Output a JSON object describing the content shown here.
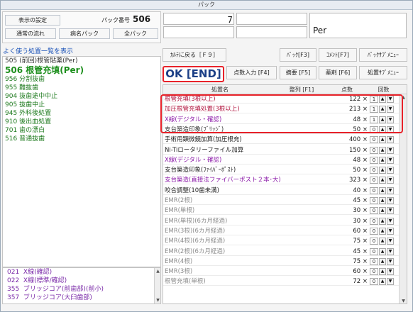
{
  "window": {
    "title": "パック"
  },
  "left_panel": {
    "display_settings": "表示の設定",
    "normal_flow": "通常の流れ",
    "disease_pack": "病名パック",
    "all_pack": "全パック",
    "pack_number_label": "パック番号",
    "pack_number": "506",
    "favorites_link": "よく使う処置一覧を表示",
    "list": [
      {
        "code": "505",
        "name": "(前回)根管貼薬(Per)"
      },
      {
        "code": "506",
        "name": "根管充填(Per)"
      },
      {
        "code": "956",
        "name": "分割抜歯"
      },
      {
        "code": "955",
        "name": "難抜歯"
      },
      {
        "code": "904",
        "name": "抜歯途中中止"
      },
      {
        "code": "905",
        "name": "抜歯中止"
      },
      {
        "code": "945",
        "name": "外科後処置"
      },
      {
        "code": "910",
        "name": "後出血処置"
      },
      {
        "code": "701",
        "name": "歯の漂白"
      },
      {
        "code": "516",
        "name": "普通抜歯"
      }
    ],
    "list2": [
      {
        "code": "021",
        "name": "X線(確認)"
      },
      {
        "code": "022",
        "name": "X線(標準/確認)"
      },
      {
        "code": "355",
        "name": "ブリッジコア(前歯部)(前小)"
      },
      {
        "code": "357",
        "name": "ブリッジコア(大臼歯部)"
      }
    ]
  },
  "right_panel": {
    "top_number": "7",
    "per_label": "Per",
    "buttons": {
      "back": "ｶﾙﾃに戻る［Ｆ９］",
      "pack": "ﾊﾟｯｸ[F3]",
      "comment": "ｺﾒﾝﾄ[F7]",
      "pack_submenu": "ﾊﾟｯｸｻﾌﾞﾒﾆｭｰ",
      "ok": "OK [END]",
      "points_input": "点数入力 [F4]",
      "summary": "摘要 [F5]",
      "drug": "薬剤 [F6]",
      "proc_submenu": "処置ｻﾌﾞﾒﾆｭｰ"
    },
    "grid": {
      "columns": {
        "name": "処置名",
        "sort": "整列 [F1]",
        "points": "点数",
        "count": "回数"
      },
      "rows": [
        {
          "name": "根管充填(3根以上)",
          "points": "122 ×",
          "count": "1",
          "color": "#b0123c"
        },
        {
          "name": "加圧根管充填処置(3根以上)",
          "points": "213 ×",
          "count": "1",
          "color": "#b0123c"
        },
        {
          "name": "X線(デジタル・確認)",
          "points": "48 ×",
          "count": "1",
          "color": "#8b1aa8"
        },
        {
          "name": "支台築造印象(ﾌﾞﾘｯｼﾞ)",
          "points": "50 ×",
          "count": "0",
          "color": "#333333"
        },
        {
          "name": "手術用顕微鏡加算(加圧根充)",
          "points": "400 ×",
          "count": "0",
          "color": "#222222"
        },
        {
          "name": "Ni-Tiロータリーファイル加算",
          "points": "150 ×",
          "count": "0",
          "color": "#222222"
        },
        {
          "name": "X線(デジタル・確認)",
          "points": "48 ×",
          "count": "0",
          "color": "#8b1aa8"
        },
        {
          "name": "支台築造印象(ﾌｧｲﾊﾞｰﾎﾟｽﾄ)",
          "points": "50 ×",
          "count": "0",
          "color": "#222222"
        },
        {
          "name": "支台築造(直接法ファイバーポスト２本･大)",
          "points": "323 ×",
          "count": "0",
          "color": "#8b1aa8"
        },
        {
          "name": "咬合調整(10歯未満)",
          "points": "40 ×",
          "count": "0",
          "color": "#222222"
        },
        {
          "name": "EMR(2根)",
          "points": "45 ×",
          "count": "0",
          "color": "#8c8c8c"
        },
        {
          "name": "EMR(単根)",
          "points": "30 ×",
          "count": "0",
          "color": "#8c8c8c"
        },
        {
          "name": "EMR(単根)(6カ月経過)",
          "points": "30 ×",
          "count": "0",
          "color": "#8c8c8c"
        },
        {
          "name": "EMR(3根)(6カ月経過)",
          "points": "60 ×",
          "count": "0",
          "color": "#8c8c8c"
        },
        {
          "name": "EMR(4根)(6カ月経過)",
          "points": "75 ×",
          "count": "0",
          "color": "#8c8c8c"
        },
        {
          "name": "EMR(2根)(6カ月経過)",
          "points": "45 ×",
          "count": "0",
          "color": "#8c8c8c"
        },
        {
          "name": "EMR(4根)",
          "points": "75 ×",
          "count": "0",
          "color": "#8c8c8c"
        },
        {
          "name": "EMR(3根)",
          "points": "60 ×",
          "count": "0",
          "color": "#8c8c8c"
        },
        {
          "name": "根管充填(単根)",
          "points": "72 ×",
          "count": "0",
          "color": "#8c8c8c"
        }
      ]
    }
  },
  "icons": {
    "up": "▲",
    "down": "▼",
    "scroll_up": "▲",
    "scroll_down": "▼"
  }
}
